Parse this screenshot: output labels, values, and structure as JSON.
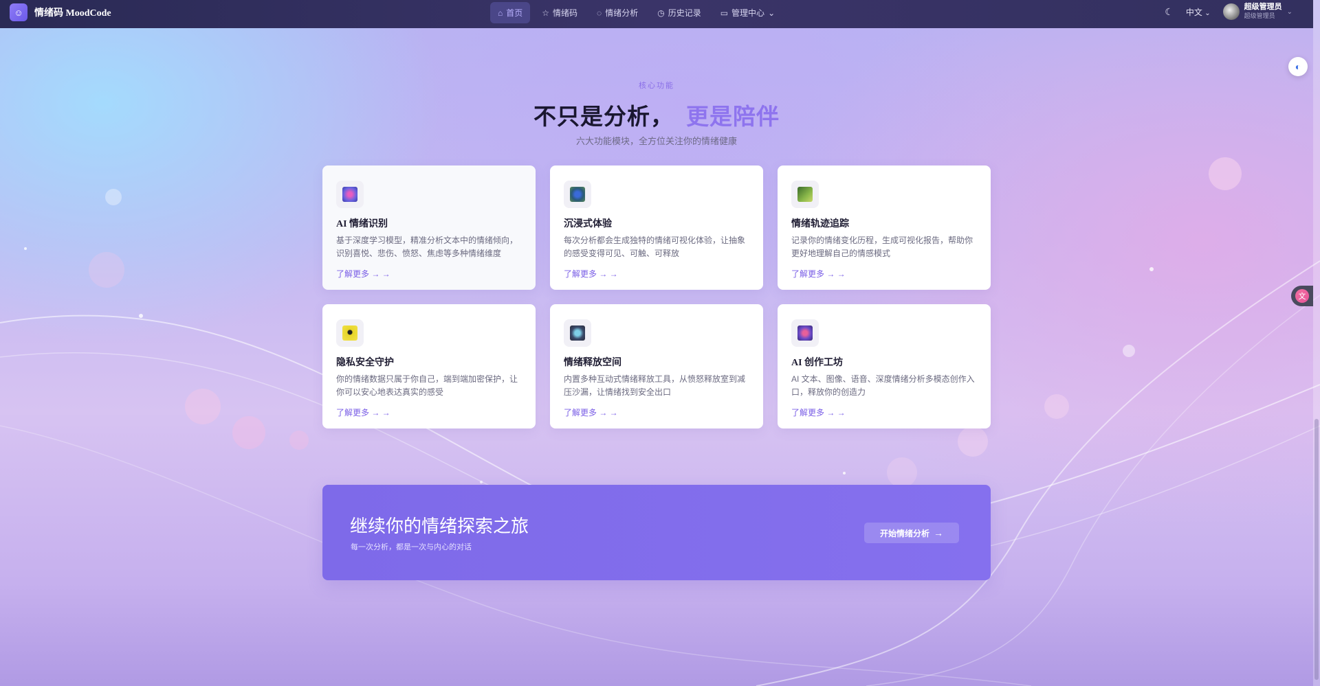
{
  "brand": {
    "logo_glyph": "☺",
    "name": "情绪码 MoodCode"
  },
  "nav": {
    "items": [
      {
        "label": "首页",
        "icon": "⌂",
        "icon_name": "home-icon",
        "active": true
      },
      {
        "label": "情绪码",
        "icon": "☆",
        "icon_name": "star-icon",
        "active": false
      },
      {
        "label": "情绪分析",
        "icon": "◌",
        "icon_name": "chat-icon",
        "active": false
      },
      {
        "label": "历史记录",
        "icon": "◷",
        "icon_name": "clock-icon",
        "active": false
      },
      {
        "label": "管理中心",
        "icon": "▭",
        "icon_name": "admin-icon",
        "active": false,
        "chevron": "⌄"
      }
    ],
    "theme_icon": "☾",
    "language": "中文",
    "language_chevron": "⌄",
    "user": {
      "name": "超级管理员",
      "role": "超级管理员",
      "chevron": "⌄"
    }
  },
  "features": {
    "eyebrow": "核心功能",
    "title_main": "不只是分析，",
    "title_highlight": "更是陪伴",
    "subtitle": "六大功能模块，全方位关注你的情绪健康",
    "cards": [
      {
        "title": "AI 情绪识别",
        "desc": "基于深度学习模型，精准分析文本中的情绪倾向，识别喜悦、悲伤、愤怒、焦虑等多种情绪维度",
        "link": "了解更多 → →",
        "icon_name": "brain-icon",
        "icon_color": "#6a62e0"
      },
      {
        "title": "沉浸式体验",
        "desc": "每次分析都会生成独特的情绪可视化体验，让抽象的感受变得可见、可触、可释放",
        "link": "了解更多 → →",
        "icon_name": "globe-icon",
        "icon_color": "#3f8fa8"
      },
      {
        "title": "情绪轨迹追踪",
        "desc": "记录你的情绪变化历程，生成可视化报告，帮助你更好地理解自己的情感模式",
        "link": "了解更多 → →",
        "icon_name": "chart-icon",
        "icon_color": "#7aa84a"
      },
      {
        "title": "隐私安全守护",
        "desc": "你的情绪数据只属于你自己，端到端加密保护，让你可以安心地表达真实的感受",
        "link": "了解更多 → →",
        "icon_name": "lock-icon",
        "icon_color": "#e7d52a"
      },
      {
        "title": "情绪释放空间",
        "desc": "内置多种互动式情绪释放工具，从愤怒释放室到减压沙漏，让情绪找到安全出口",
        "link": "了解更多 → →",
        "icon_name": "orb-icon",
        "icon_color": "#4a6a8a"
      },
      {
        "title": "AI 创作工坊",
        "desc": "AI 文本、图像、语音、深度情绪分析多模态创作入口，释放你的创造力",
        "link": "了解更多 → →",
        "icon_name": "palette-icon",
        "icon_color": "#8a5ad0"
      }
    ]
  },
  "cta": {
    "title": "继续你的情绪探索之旅",
    "subtitle": "每一次分析，都是一次与内心的对话",
    "button": "开始情绪分析",
    "button_arrow": "→"
  },
  "floating": {
    "assistant_glyph": "◐",
    "side_glyph": "文"
  }
}
